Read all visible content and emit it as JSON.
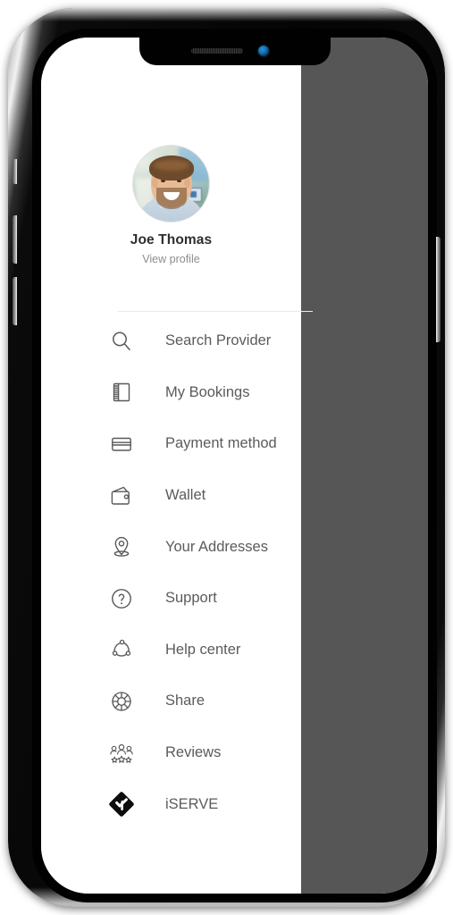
{
  "device": {
    "type": "smartphone-mockup",
    "notch": {
      "speaker": "speaker-grille",
      "camera": "front-camera"
    },
    "buttons": [
      "silence-switch",
      "volume-up",
      "volume-down",
      "power"
    ]
  },
  "drawer": {
    "background_color": "#ffffff",
    "scrim_color": "#565656",
    "divider_color": "#e9e9e9"
  },
  "profile": {
    "name": "Joe Thomas",
    "link_label": "View profile",
    "avatar": "user-avatar-photo",
    "name_color": "#2e2e2e",
    "link_color": "#8d8d8d"
  },
  "menu": {
    "label_color": "#5a5b5d",
    "icon_color": "#58595b",
    "items": [
      {
        "label": "Search Provider",
        "icon": "search-icon"
      },
      {
        "label": "My Bookings",
        "icon": "notebook-icon"
      },
      {
        "label": "Payment method",
        "icon": "credit-card-icon"
      },
      {
        "label": "Wallet",
        "icon": "wallet-icon"
      },
      {
        "label": "Your Addresses",
        "icon": "map-pin-icon"
      },
      {
        "label": "Support",
        "icon": "question-circle-icon"
      },
      {
        "label": "Help center",
        "icon": "network-nodes-icon"
      },
      {
        "label": "Share",
        "icon": "lifebuoy-icon"
      },
      {
        "label": "Reviews",
        "icon": "people-stars-icon"
      },
      {
        "label": "iSERVE",
        "icon": "iserve-logo-icon"
      }
    ]
  }
}
